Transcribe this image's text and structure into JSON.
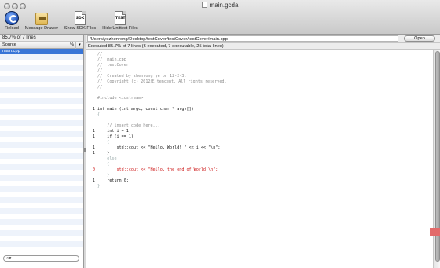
{
  "window": {
    "title": "main.gcda"
  },
  "toolbar": {
    "items": [
      {
        "label": "Reload",
        "icon": "reload-icon"
      },
      {
        "label": "Message Drawer",
        "icon": "drawer-icon"
      },
      {
        "label": "Show SDK Files",
        "icon": "sdk-document-icon",
        "badge": "SDK"
      },
      {
        "label": "Hide Unittest Files",
        "icon": "test-document-icon",
        "badge": "TEST"
      }
    ]
  },
  "sidebar": {
    "summary": "85.7% of 7 lines",
    "columns": {
      "source": "Source",
      "percent": "%",
      "sort": "▾"
    },
    "files": [
      {
        "name": "main.cpp",
        "selected": true
      }
    ],
    "search": {
      "icon": "search-icon",
      "glyph": "⌕▾",
      "placeholder": ""
    }
  },
  "main": {
    "path": "/Users/yezhenrong/Desktop/testCover/testCover/testCover/main.cpp",
    "open_label": "Open",
    "status": "Executed 85.7% of 7 lines (6 executed, 7 executable, 25 total lines)"
  },
  "code": {
    "lines": [
      {
        "count": "",
        "text": "//",
        "kind": "comment"
      },
      {
        "count": "",
        "text": "//  main.cpp",
        "kind": "comment"
      },
      {
        "count": "",
        "text": "//  testCover",
        "kind": "comment"
      },
      {
        "count": "",
        "text": "//",
        "kind": "comment"
      },
      {
        "count": "",
        "text": "//  Created by zhenrong ye on 12-2-3.",
        "kind": "comment"
      },
      {
        "count": "",
        "text": "//  Copyright (c) 2012年 tencent. All rights reserved.",
        "kind": "comment"
      },
      {
        "count": "",
        "text": "//",
        "kind": "comment"
      },
      {
        "count": "",
        "text": "",
        "kind": "code"
      },
      {
        "count": "",
        "text": "#include <iostream>",
        "kind": "pre"
      },
      {
        "count": "",
        "text": "",
        "kind": "code"
      },
      {
        "count": "1",
        "text": "int main (int argc, const char * argv[])",
        "kind": "code"
      },
      {
        "count": "",
        "text": "{",
        "kind": "dim"
      },
      {
        "count": "",
        "text": "",
        "kind": "code"
      },
      {
        "count": "",
        "text": "    // insert code here...",
        "kind": "comment"
      },
      {
        "count": "1",
        "text": "    int i = 1;",
        "kind": "code"
      },
      {
        "count": "1",
        "text": "    if (i == 1)",
        "kind": "code"
      },
      {
        "count": "",
        "text": "    {",
        "kind": "dim"
      },
      {
        "count": "1",
        "text": "        std::cout << \"Hello, World! \" << i << \"\\n\";",
        "kind": "code"
      },
      {
        "count": "1",
        "text": "    }",
        "kind": "code"
      },
      {
        "count": "",
        "text": "    else",
        "kind": "dim"
      },
      {
        "count": "",
        "text": "    {",
        "kind": "dim"
      },
      {
        "count": "0",
        "text": "        std::cout << \"Hello, the end of World!\\n\";",
        "kind": "missed"
      },
      {
        "count": "",
        "text": "    }",
        "kind": "dim"
      },
      {
        "count": "1",
        "text": "    return 0;",
        "kind": "code"
      },
      {
        "count": "",
        "text": "}",
        "kind": "dim"
      }
    ]
  },
  "colors": {
    "selection": "#3875d7",
    "missed": "#cc1111",
    "miss_marker": "#e36b6b"
  }
}
